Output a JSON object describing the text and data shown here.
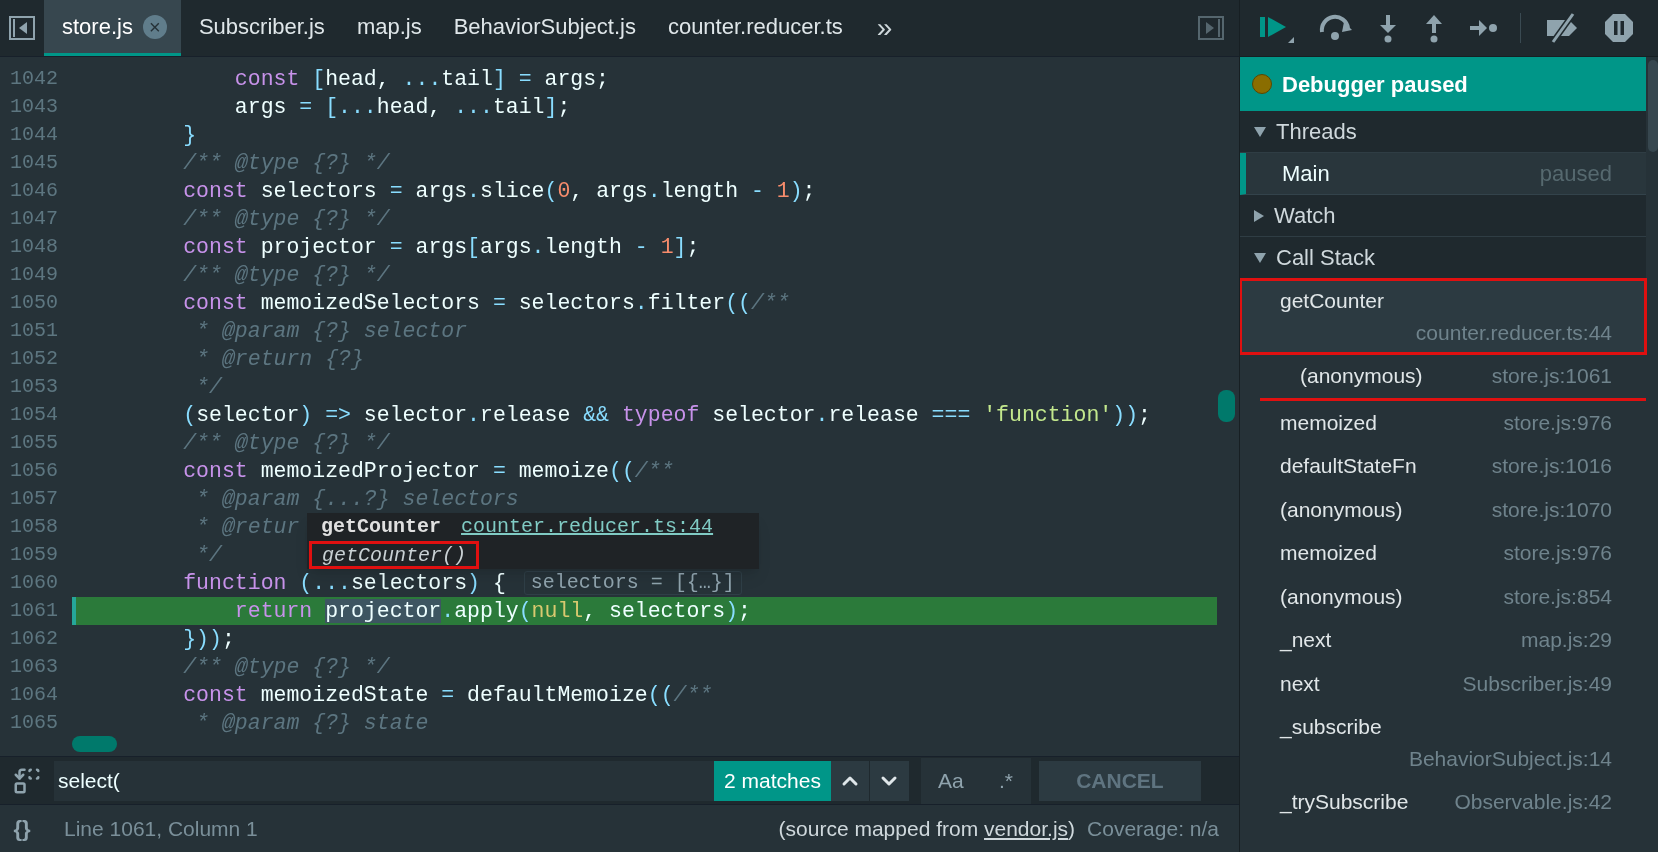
{
  "editor": {
    "tabs": [
      {
        "label": "store.js",
        "selected": true,
        "close": "×"
      },
      {
        "label": "Subscriber.js",
        "selected": false
      },
      {
        "label": "map.js",
        "selected": false
      },
      {
        "label": "BehaviorSubject.js",
        "selected": false
      },
      {
        "label": "counter.reducer.ts",
        "selected": false
      }
    ],
    "more_tabs": "»",
    "lines": [
      {
        "number": "1042",
        "current": false,
        "tokens": [
          {
            "kind": "keyword",
            "text": "            const "
          },
          {
            "kind": "punct",
            "text": "["
          },
          {
            "kind": "plain",
            "text": "head, "
          },
          {
            "kind": "punct",
            "text": "..."
          },
          {
            "kind": "plain",
            "text": "tail"
          },
          {
            "kind": "punct",
            "text": "] = "
          },
          {
            "kind": "plain",
            "text": "args;"
          }
        ]
      },
      {
        "number": "1043",
        "current": false,
        "tokens": [
          {
            "kind": "plain",
            "text": "            args "
          },
          {
            "kind": "punct",
            "text": "= [..."
          },
          {
            "kind": "plain",
            "text": "head, "
          },
          {
            "kind": "punct",
            "text": "..."
          },
          {
            "kind": "plain",
            "text": "tail"
          },
          {
            "kind": "punct",
            "text": "]"
          },
          {
            "kind": "plain",
            "text": ";"
          }
        ]
      },
      {
        "number": "1044",
        "current": false,
        "tokens": [
          {
            "kind": "punct",
            "text": "        }"
          }
        ]
      },
      {
        "number": "1045",
        "current": false,
        "tokens": [
          {
            "kind": "comment",
            "text": "        /** @type {?} */"
          }
        ]
      },
      {
        "number": "1046",
        "current": false,
        "tokens": [
          {
            "kind": "keyword",
            "text": "        const "
          },
          {
            "kind": "plain",
            "text": "selectors "
          },
          {
            "kind": "punct",
            "text": "= "
          },
          {
            "kind": "plain",
            "text": "args"
          },
          {
            "kind": "punct",
            "text": "."
          },
          {
            "kind": "plain",
            "text": "slice"
          },
          {
            "kind": "punct",
            "text": "("
          },
          {
            "kind": "number",
            "text": "0"
          },
          {
            "kind": "plain",
            "text": ", args"
          },
          {
            "kind": "punct",
            "text": "."
          },
          {
            "kind": "plain",
            "text": "length "
          },
          {
            "kind": "punct",
            "text": "- "
          },
          {
            "kind": "number",
            "text": "1"
          },
          {
            "kind": "punct",
            "text": ")"
          },
          {
            "kind": "plain",
            "text": ";"
          }
        ]
      },
      {
        "number": "1047",
        "current": false,
        "tokens": [
          {
            "kind": "comment",
            "text": "        /** @type {?} */"
          }
        ]
      },
      {
        "number": "1048",
        "current": false,
        "tokens": [
          {
            "kind": "keyword",
            "text": "        const "
          },
          {
            "kind": "plain",
            "text": "projector "
          },
          {
            "kind": "punct",
            "text": "= "
          },
          {
            "kind": "plain",
            "text": "args"
          },
          {
            "kind": "punct",
            "text": "["
          },
          {
            "kind": "plain",
            "text": "args"
          },
          {
            "kind": "punct",
            "text": "."
          },
          {
            "kind": "plain",
            "text": "length "
          },
          {
            "kind": "punct",
            "text": "- "
          },
          {
            "kind": "number",
            "text": "1"
          },
          {
            "kind": "punct",
            "text": "]"
          },
          {
            "kind": "plain",
            "text": ";"
          }
        ]
      },
      {
        "number": "1049",
        "current": false,
        "tokens": [
          {
            "kind": "comment",
            "text": "        /** @type {?} */"
          }
        ]
      },
      {
        "number": "1050",
        "current": false,
        "tokens": [
          {
            "kind": "keyword",
            "text": "        const "
          },
          {
            "kind": "plain",
            "text": "memoizedSelectors "
          },
          {
            "kind": "punct",
            "text": "= "
          },
          {
            "kind": "plain",
            "text": "selectors"
          },
          {
            "kind": "punct",
            "text": "."
          },
          {
            "kind": "plain",
            "text": "filter"
          },
          {
            "kind": "punct",
            "text": "(("
          },
          {
            "kind": "comment",
            "text": "/**"
          }
        ]
      },
      {
        "number": "1051",
        "current": false,
        "tokens": [
          {
            "kind": "comment",
            "text": "         * @param {?} selector"
          }
        ]
      },
      {
        "number": "1052",
        "current": false,
        "tokens": [
          {
            "kind": "comment",
            "text": "         * @return {?}"
          }
        ]
      },
      {
        "number": "1053",
        "current": false,
        "tokens": [
          {
            "kind": "comment",
            "text": "         */"
          }
        ]
      },
      {
        "number": "1054",
        "current": false,
        "tokens": [
          {
            "kind": "punct",
            "text": "        ("
          },
          {
            "kind": "plain",
            "text": "selector"
          },
          {
            "kind": "punct",
            "text": ") => "
          },
          {
            "kind": "plain",
            "text": "selector"
          },
          {
            "kind": "punct",
            "text": "."
          },
          {
            "kind": "plain",
            "text": "release "
          },
          {
            "kind": "punct",
            "text": "&& "
          },
          {
            "kind": "keyword",
            "text": "typeof "
          },
          {
            "kind": "plain",
            "text": "selector"
          },
          {
            "kind": "punct",
            "text": "."
          },
          {
            "kind": "plain",
            "text": "release "
          },
          {
            "kind": "punct",
            "text": "=== "
          },
          {
            "kind": "string",
            "text": "'function'"
          },
          {
            "kind": "punct",
            "text": "))"
          },
          {
            "kind": "plain",
            "text": ";"
          }
        ]
      },
      {
        "number": "1055",
        "current": false,
        "tokens": [
          {
            "kind": "comment",
            "text": "        /** @type {?} */"
          }
        ]
      },
      {
        "number": "1056",
        "current": false,
        "tokens": [
          {
            "kind": "keyword",
            "text": "        const "
          },
          {
            "kind": "plain",
            "text": "memoizedProjector "
          },
          {
            "kind": "punct",
            "text": "= "
          },
          {
            "kind": "plain",
            "text": "memoize"
          },
          {
            "kind": "punct",
            "text": "(("
          },
          {
            "kind": "comment",
            "text": "/**"
          }
        ]
      },
      {
        "number": "1057",
        "current": false,
        "tokens": [
          {
            "kind": "comment",
            "text": "         * @param {...?} selectors"
          }
        ]
      },
      {
        "number": "1058",
        "current": false,
        "tokens": [
          {
            "kind": "comment",
            "text": "         * @retur"
          }
        ]
      },
      {
        "number": "1059",
        "current": false,
        "tokens": [
          {
            "kind": "comment",
            "text": "         */"
          }
        ]
      },
      {
        "number": "1060",
        "current": false,
        "tokens": [
          {
            "kind": "keyword",
            "text": "        function "
          },
          {
            "kind": "punct",
            "text": "(..."
          },
          {
            "kind": "plain",
            "text": "selectors"
          },
          {
            "kind": "punct",
            "text": ") "
          },
          {
            "kind": "plain",
            "text": "{"
          }
        ],
        "inline_value": "selectors = [{…}]"
      },
      {
        "number": "1061",
        "current": true,
        "tokens": [
          {
            "kind": "keyword",
            "text": "            return "
          },
          {
            "kind": "hovered",
            "text": "projector"
          },
          {
            "kind": "punct",
            "text": "."
          },
          {
            "kind": "plain",
            "text": "apply"
          },
          {
            "kind": "punct",
            "text": "("
          },
          {
            "kind": "literal",
            "text": "null"
          },
          {
            "kind": "plain",
            "text": ", selectors"
          },
          {
            "kind": "punct",
            "text": ")"
          },
          {
            "kind": "plain",
            "text": ";"
          }
        ]
      },
      {
        "number": "1062",
        "current": false,
        "tokens": [
          {
            "kind": "punct",
            "text": "        }))"
          },
          {
            "kind": "plain",
            "text": ";"
          }
        ]
      },
      {
        "number": "1063",
        "current": false,
        "tokens": [
          {
            "kind": "comment",
            "text": "        /** @type {?} */"
          }
        ]
      },
      {
        "number": "1064",
        "current": false,
        "tokens": [
          {
            "kind": "keyword",
            "text": "        const "
          },
          {
            "kind": "plain",
            "text": "memoizedState "
          },
          {
            "kind": "punct",
            "text": "= "
          },
          {
            "kind": "plain",
            "text": "defaultMemoize"
          },
          {
            "kind": "punct",
            "text": "(("
          },
          {
            "kind": "comment",
            "text": "/**"
          }
        ]
      },
      {
        "number": "1065",
        "current": false,
        "tokens": [
          {
            "kind": "comment",
            "text": "         * @param {?} state"
          }
        ]
      }
    ],
    "tooltip": {
      "function": "getCounter",
      "location": "counter.reducer.ts:44",
      "signature": "getCounter()",
      "annotated": true
    },
    "search": {
      "value": "select(",
      "matches": "2 matches",
      "match_case": "Aa",
      "regex": ".*",
      "cancel": "CANCEL"
    },
    "status_bar": {
      "format_button": "{}",
      "position": "Line 1061, Column 1",
      "source_prefix": "(source mapped from ",
      "source_link": "vendor.js",
      "source_suffix": ")",
      "coverage": "Coverage: n/a"
    }
  },
  "debugger": {
    "banner": "Debugger paused",
    "sections": [
      {
        "title": "Threads",
        "expanded": true
      },
      {
        "title": "Watch",
        "expanded": false
      },
      {
        "title": "Call Stack",
        "expanded": true
      }
    ],
    "threads": [
      {
        "name": "Main",
        "status": "paused",
        "selected": true
      }
    ],
    "call_stack": [
      {
        "name": "getCounter",
        "location": "counter.reducer.ts:44",
        "selected": true,
        "boxed": true,
        "underlined": false
      },
      {
        "name": "(anonymous)",
        "location": "store.js:1061",
        "selected": false,
        "boxed": false,
        "underlined": true
      },
      {
        "name": "memoized",
        "location": "store.js:976",
        "selected": false,
        "boxed": false,
        "underlined": false
      },
      {
        "name": "defaultStateFn",
        "location": "store.js:1016",
        "selected": false,
        "boxed": false,
        "underlined": false
      },
      {
        "name": "(anonymous)",
        "location": "store.js:1070",
        "selected": false,
        "boxed": false,
        "underlined": false
      },
      {
        "name": "memoized",
        "location": "store.js:976",
        "selected": false,
        "boxed": false,
        "underlined": false
      },
      {
        "name": "(anonymous)",
        "location": "store.js:854",
        "selected": false,
        "boxed": false,
        "underlined": false
      },
      {
        "name": "_next",
        "location": "map.js:29",
        "selected": false,
        "boxed": false,
        "underlined": false
      },
      {
        "name": "next",
        "location": "Subscriber.js:49",
        "selected": false,
        "boxed": false,
        "underlined": false
      },
      {
        "name": "_subscribe",
        "location": "BehaviorSubject.js:14",
        "selected": false,
        "boxed": false,
        "underlined": false
      },
      {
        "name": "_trySubscribe",
        "location": "Observable.js:42",
        "selected": false,
        "boxed": false,
        "underlined": false
      }
    ]
  }
}
